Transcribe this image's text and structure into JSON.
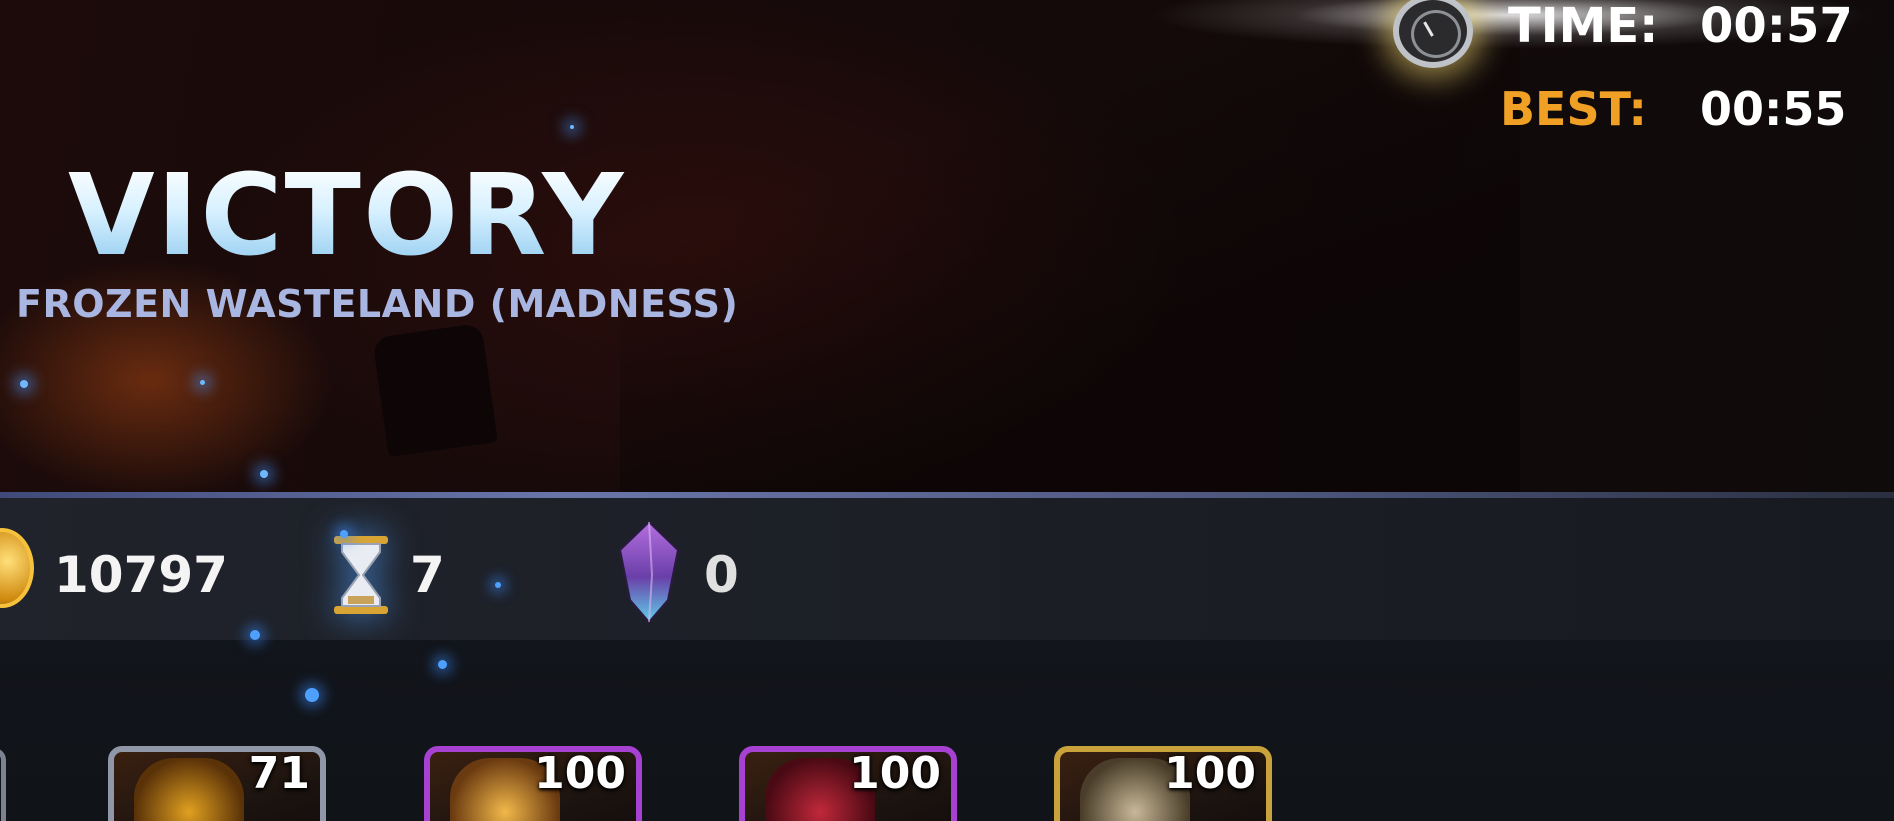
{
  "battle": {
    "title": "VICTORY",
    "subtitle": "FROZEN WASTELAND (MADNESS)"
  },
  "timer": {
    "time_label": "TIME:",
    "time_value": "00:57",
    "best_label": "BEST:",
    "best_value": "00:55",
    "icon": "clock-icon"
  },
  "rewards": {
    "gold": {
      "icon": "gold-coin-icon",
      "value": "10797"
    },
    "hourglass": {
      "icon": "hourglass-icon",
      "value": "7"
    },
    "crystal": {
      "icon": "crystal-icon",
      "value": "0"
    }
  },
  "champions": [
    {
      "level": "71",
      "frame": "silver"
    },
    {
      "level": "100",
      "frame": "purple"
    },
    {
      "level": "100",
      "frame": "purple"
    },
    {
      "level": "100",
      "frame": "gold"
    }
  ],
  "colors": {
    "title": "#d5eefc",
    "subtitle": "#a9b6e2",
    "best_label": "#f0a025",
    "frame_purple": "#a641d2",
    "frame_gold": "#c9a23c",
    "frame_silver": "#8f97a8"
  }
}
